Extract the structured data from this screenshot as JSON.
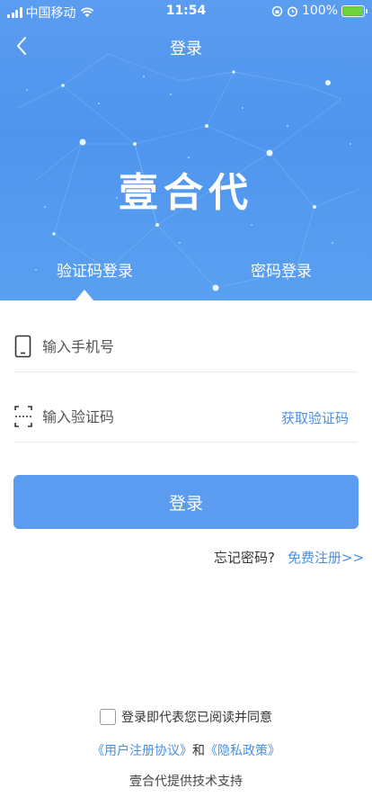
{
  "status_bar": {
    "carrier": "中国移动",
    "time": "11:54",
    "battery": "100%"
  },
  "nav": {
    "title": "登录"
  },
  "brand": {
    "name": "壹合代"
  },
  "tabs": [
    {
      "label": "验证码登录",
      "active": true
    },
    {
      "label": "密码登录",
      "active": false
    }
  ],
  "form": {
    "phone_placeholder": "输入手机号",
    "code_placeholder": "输入验证码",
    "get_code_label": "获取验证码",
    "login_label": "登录"
  },
  "links": {
    "forgot_password": "忘记密码?",
    "register": "免费注册>>"
  },
  "agreement": {
    "text": "登录即代表您已阅读并同意",
    "user_agreement": "《用户注册协议》",
    "and": "和",
    "privacy_policy": "《隐私政策》"
  },
  "footer": {
    "support": "壹合代提供技术支持"
  },
  "colors": {
    "hero": "#5a9cf0",
    "accent": "#4a90e2",
    "button": "#5b9cf0"
  }
}
